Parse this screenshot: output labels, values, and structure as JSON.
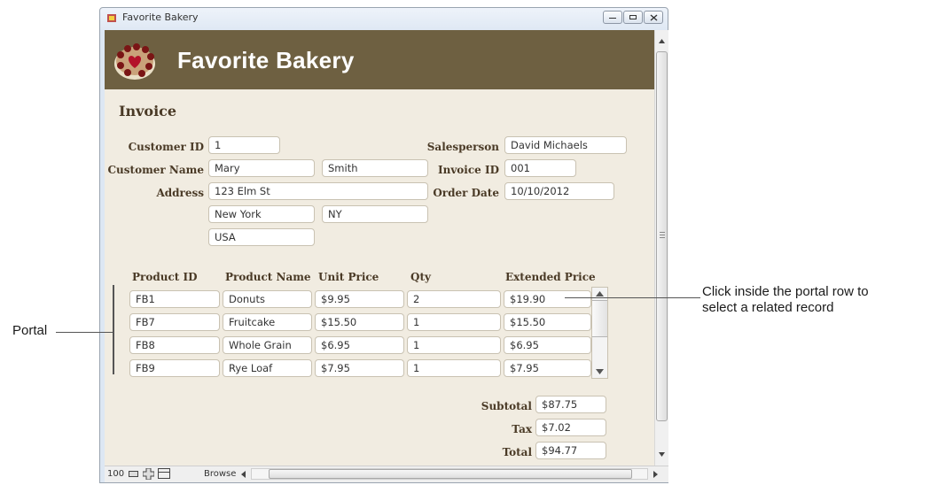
{
  "window": {
    "title": "Favorite Bakery"
  },
  "header": {
    "title": "Favorite Bakery"
  },
  "invoice": {
    "heading": "Invoice",
    "customer_id_label": "Customer ID",
    "customer_id": "1",
    "customer_name_label": "Customer Name",
    "first_name": "Mary",
    "last_name": "Smith",
    "address_label": "Address",
    "street": "123 Elm St",
    "city": "New York",
    "state": "NY",
    "country": "USA",
    "salesperson_label": "Salesperson",
    "salesperson": "David Michaels",
    "invoice_id_label": "Invoice ID",
    "invoice_id": "001",
    "order_date_label": "Order Date",
    "order_date": "10/10/2012"
  },
  "portal": {
    "columns": [
      "Product ID",
      "Product Name",
      "Unit Price",
      "Qty",
      "Extended Price"
    ],
    "rows": [
      [
        "FB1",
        "Donuts",
        "$9.95",
        "2",
        "$19.90"
      ],
      [
        "FB7",
        "Fruitcake",
        "$15.50",
        "1",
        "$15.50"
      ],
      [
        "FB8",
        "Whole Grain",
        "$6.95",
        "1",
        "$6.95"
      ],
      [
        "FB9",
        "Rye Loaf",
        "$7.95",
        "1",
        "$7.95"
      ]
    ]
  },
  "totals": {
    "subtotal_label": "Subtotal",
    "subtotal": "$87.75",
    "tax_label": "Tax",
    "tax": "$7.02",
    "total_label": "Total",
    "total": "$94.77"
  },
  "statusbar": {
    "zoom": "100",
    "mode": "Browse"
  },
  "callouts": {
    "portal": "Portal",
    "row_line1": "Click inside the portal row to",
    "row_line2": "select a related record"
  },
  "colors": {
    "header_band": "#6e6041",
    "layout_bg": "#f1ece1",
    "label_text": "#4a3a26"
  }
}
